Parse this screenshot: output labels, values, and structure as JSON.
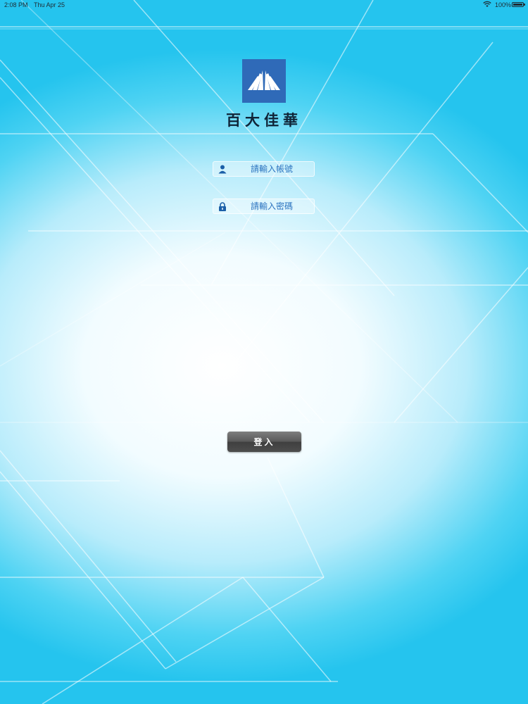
{
  "status_bar": {
    "time": "2:08 PM",
    "date": "Thu Apr 25",
    "battery": "100%",
    "wifi_icon": "wifi-icon",
    "battery_icon": "battery-icon"
  },
  "brand": {
    "logo_icon": "company-logo",
    "name": "百大佳華",
    "logo_color": "#2f6ab8"
  },
  "login_form": {
    "username": {
      "placeholder": "請輸入帳號",
      "value": "",
      "icon": "user-icon"
    },
    "password": {
      "placeholder": "請輸入密碼",
      "value": "",
      "icon": "lock-icon"
    },
    "submit_label": "登入"
  },
  "colors": {
    "field_text": "#2b74c0",
    "button": "#555555",
    "background_edge": "#25c4ee"
  }
}
